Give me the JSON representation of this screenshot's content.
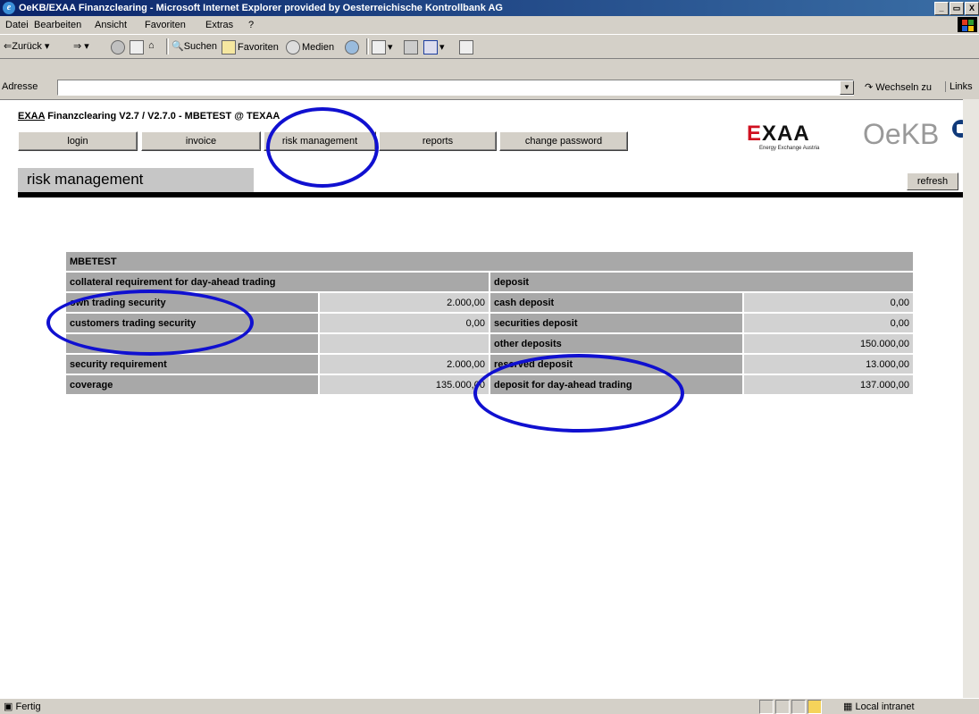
{
  "window": {
    "title": "OeKB/EXAA Finanzclearing - Microsoft Internet Explorer provided by Oesterreichische Kontrollbank AG",
    "controls": [
      "_",
      "▭",
      "X"
    ]
  },
  "menu": [
    "Datei",
    "Bearbeiten",
    "Ansicht",
    "Favoriten",
    "Extras",
    "?"
  ],
  "toolbar": {
    "back": "Zurück",
    "search": "Suchen",
    "favorites": "Favoriten",
    "media": "Medien"
  },
  "address": {
    "label": "Adresse",
    "value": "",
    "go": "Wechseln zu",
    "links": "Links"
  },
  "app": {
    "title_link": "EXAA",
    "title_rest": " Finanzclearing V2.7 / V2.7.0 - MBETEST @ TEXAA",
    "nav": [
      "login",
      "invoice",
      "risk management",
      "reports",
      "change password"
    ],
    "logo_exaa_sub": "Energy Exchange Austria",
    "section": "risk management",
    "refresh": "refresh"
  },
  "table": {
    "account": "MBETEST",
    "left_header": "collateral requirement for day-ahead trading",
    "right_header": "deposit",
    "rows": [
      {
        "l_label": "own trading security",
        "l_value": "2.000,00",
        "r_label": "cash deposit",
        "r_value": "0,00"
      },
      {
        "l_label": "customers trading security",
        "l_value": "0,00",
        "r_label": "securities deposit",
        "r_value": "0,00"
      },
      {
        "l_label": "",
        "l_value": "",
        "r_label": "other deposits",
        "r_value": "150.000,00"
      },
      {
        "l_label": "security requirement",
        "l_value": "2.000,00",
        "r_label": "reserved deposit",
        "r_value": "13.000,00"
      },
      {
        "l_label": "coverage",
        "l_value": "135.000,00",
        "r_label": "deposit for day-ahead trading",
        "r_value": "137.000,00"
      }
    ]
  },
  "status": {
    "left": "Fertig",
    "zone": "Local intranet"
  },
  "colors": {
    "annotation": "#1010d0",
    "title_bar": "#0a246a",
    "label_cell": "#a8a8a8",
    "value_cell": "#d2d2d2"
  }
}
